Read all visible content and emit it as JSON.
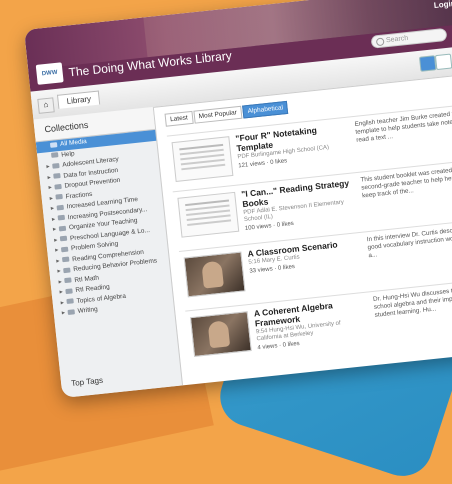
{
  "header": {
    "login_label": "Login",
    "site_title": "The Doing What Works Library",
    "logo_text": "DWW",
    "search_placeholder": "Search"
  },
  "toolbar": {
    "home_icon": "⌂",
    "tab_label": "Library"
  },
  "sidebar": {
    "title": "Collections",
    "items": [
      {
        "label": "All Media",
        "selected": true,
        "expandable": false
      },
      {
        "label": "Help",
        "selected": false,
        "expandable": false
      },
      {
        "label": "Adolescent Literacy",
        "selected": false,
        "expandable": true
      },
      {
        "label": "Data for Instruction",
        "selected": false,
        "expandable": true
      },
      {
        "label": "Dropout Prevention",
        "selected": false,
        "expandable": true
      },
      {
        "label": "Fractions",
        "selected": false,
        "expandable": true
      },
      {
        "label": "Increased Learning Time",
        "selected": false,
        "expandable": true
      },
      {
        "label": "Increasing Postsecondary...",
        "selected": false,
        "expandable": true
      },
      {
        "label": "Organize Your Teaching",
        "selected": false,
        "expandable": true
      },
      {
        "label": "Preschool Language & Lo...",
        "selected": false,
        "expandable": true
      },
      {
        "label": "Problem Solving",
        "selected": false,
        "expandable": true
      },
      {
        "label": "Reading Comprehension",
        "selected": false,
        "expandable": true
      },
      {
        "label": "Reducing Behavior Problems",
        "selected": false,
        "expandable": true
      },
      {
        "label": "RtI Math",
        "selected": false,
        "expandable": true
      },
      {
        "label": "RtI Reading",
        "selected": false,
        "expandable": true
      },
      {
        "label": "Topics of Algebra",
        "selected": false,
        "expandable": true
      },
      {
        "label": "Writing",
        "selected": false,
        "expandable": true
      }
    ],
    "top_tags": "Top Tags"
  },
  "filters": [
    {
      "label": "Latest",
      "active": false
    },
    {
      "label": "Most Popular",
      "active": false
    },
    {
      "label": "Alphabetical",
      "active": true
    }
  ],
  "items": [
    {
      "title": "\"Four R\" Notetaking Template",
      "meta": "PDF Burlingame High School (CA)",
      "stats": "121 views  ·  0 likes",
      "desc": "English teacher Jim Burke created this template to help students take notes as they read a text ...",
      "thumb": "doc"
    },
    {
      "title": "\"I Can...\" Reading Strategy Books",
      "meta": "PDF Adlai E. Stevenson II Elementary School (IL)",
      "stats": "100 views  ·  0 likes",
      "desc": "This student booklet was created by a second-grade teacher to help her students keep track of the...",
      "thumb": "doc"
    },
    {
      "title": "A Classroom Scenario",
      "meta": "5:16 Mary E. Curtis",
      "stats": "33 views  ·  0 likes",
      "desc": "In this interview Dr. Curtis describes what good vocabulary instruction would look like in a...",
      "thumb": "video"
    },
    {
      "title": "A Coherent Algebra Framework",
      "meta": "9:54 Hung-Hsi Wu, University of California at Berkeley",
      "stats": "4 views  ·  0 likes",
      "desc": "Dr. Hung-Hsi Wu discusses the topics of school algebra and their importance for student learning. Hu...",
      "thumb": "video"
    }
  ]
}
